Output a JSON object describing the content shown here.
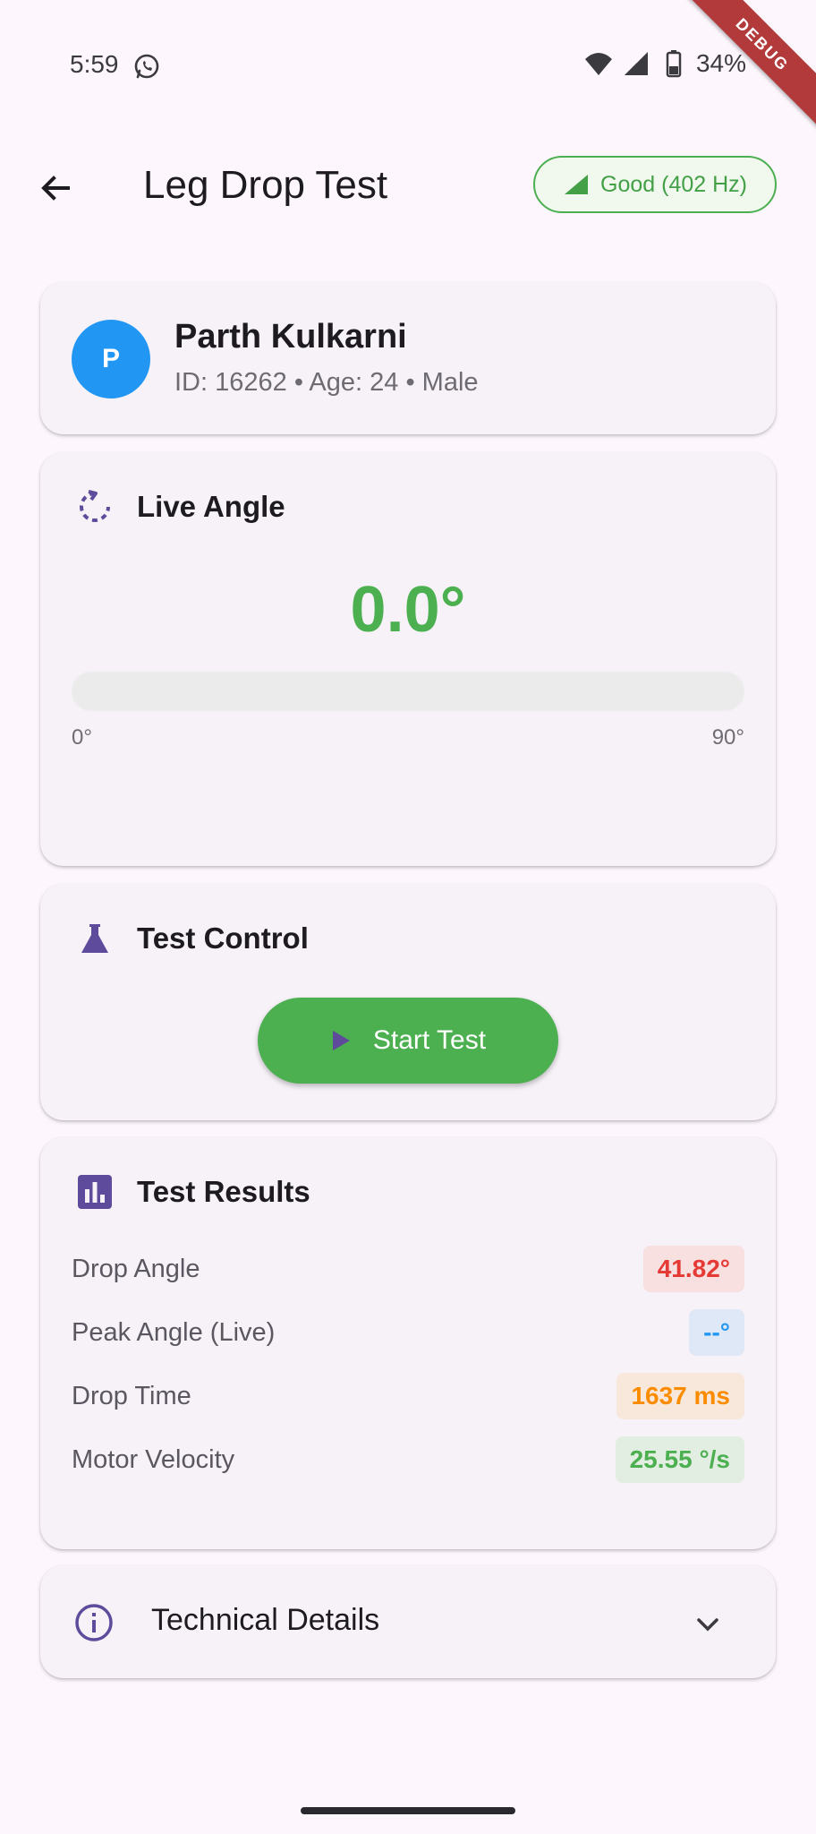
{
  "status_bar": {
    "time": "5:59",
    "battery": "34%"
  },
  "debug_banner": "DEBUG",
  "app_bar": {
    "title": "Leg Drop Test",
    "signal_status": "Good (402 Hz)"
  },
  "patient": {
    "initial": "P",
    "name": "Parth Kulkarni",
    "meta": "ID: 16262 • Age: 24 • Male"
  },
  "live_angle": {
    "title": "Live Angle",
    "value": "0.0°",
    "progress_fraction": 0,
    "min_label": "0°",
    "max_label": "90°"
  },
  "test_control": {
    "title": "Test Control",
    "start_label": "Start Test"
  },
  "results": {
    "title": "Test Results",
    "rows": [
      {
        "label": "Drop Angle",
        "value": "41.82°",
        "color": "#E53935",
        "bg": "#F8DFE0"
      },
      {
        "label": "Peak Angle (Live)",
        "value": "--°",
        "color": "#2196F3",
        "bg": "#DFE8F6"
      },
      {
        "label": "Drop Time",
        "value": "1637 ms",
        "color": "#FB8C00",
        "bg": "#F8E8DB"
      },
      {
        "label": "Motor Velocity",
        "value": "25.55 °/s",
        "color": "#4CAF50",
        "bg": "#E2EEE1"
      }
    ]
  },
  "technical_details": {
    "title": "Technical Details"
  },
  "colors": {
    "accent": "#4CAF50",
    "primary_purple": "#5E4B9B",
    "avatar": "#2196F3"
  },
  "icons": {
    "back": "arrow-left-icon",
    "signal": "signal-icon",
    "live_angle": "rotate-icon",
    "test_control": "flask-icon",
    "results": "bar-chart-icon",
    "start": "play-icon",
    "info": "info-icon",
    "expand": "chevron-down-icon"
  }
}
